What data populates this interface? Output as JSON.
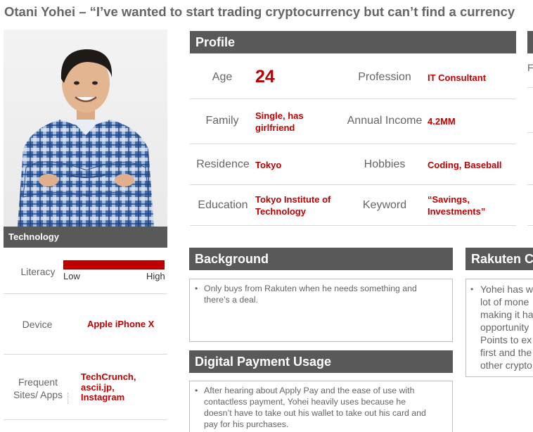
{
  "title": "Otani Yohei – “I’ve wanted to start trading cryptocurrency but can’t find a currency",
  "technology": {
    "header": "Technology",
    "literacy_label": "Literacy",
    "literacy_low": "Low",
    "literacy_high": "High",
    "literacy_level": 1.0,
    "device_label": "Device",
    "device_value": "Apple iPhone X",
    "sites_label_1": "Frequent",
    "sites_label_2": "Sites/ Apps",
    "sites_value_1": "TechCrunch,",
    "sites_value_2": "ascii.jp,",
    "sites_value_3": "Instagram"
  },
  "profile": {
    "header": "Profile",
    "age_label": "Age",
    "age_value": "24",
    "profession_label": "Profession",
    "profession_value": "IT Consultant",
    "family_label": "Family",
    "family_value_1": "Single, has",
    "family_value_2": "girlfriend",
    "income_label": "Annual Income",
    "income_value": "4.2MM",
    "residence_label": "Residence",
    "residence_value": "Tokyo",
    "hobbies_label": "Hobbies",
    "hobbies_value": "Coding, Baseball",
    "education_label": "Education",
    "education_value_1": "Tokyo Institute of",
    "education_value_2": "Technology",
    "keyword_label": "Keyword",
    "keyword_value_1": "“Savings,",
    "keyword_value_2": "Investments”"
  },
  "background": {
    "header": "Background",
    "bullet_1": "Only buys from Rakuten when he needs something and",
    "bullet_2": "there’s a deal."
  },
  "payment": {
    "header": "Digital Payment Usage",
    "line_1": "After hearing about Apply Pay and the ease of use with",
    "line_2": "contactless payment, Yohei heavily uses because he",
    "line_3": "doesn’t have to take out his wallet to take out his card and",
    "line_4": "pay for his purchases."
  },
  "rakuten": {
    "header": "Rakuten C",
    "line_1": "Yohei has w",
    "line_2": "lot of mone",
    "line_3": "making it ha",
    "line_4": "opportunity",
    "line_5": "Points to ex",
    "line_6": "first and the",
    "line_7": "other crypto"
  },
  "right_fragment": {
    "letter": "F"
  },
  "colors": {
    "accent": "#c00000",
    "header_bg": "#595959"
  }
}
